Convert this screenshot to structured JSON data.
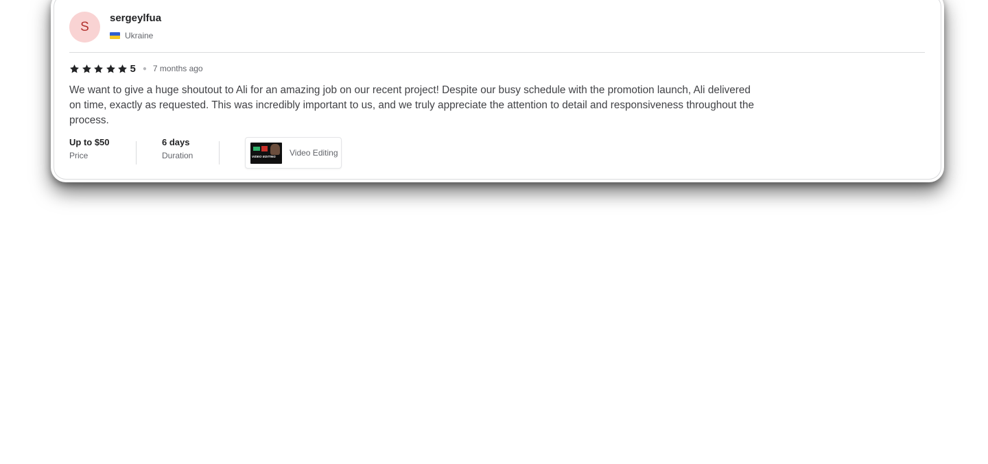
{
  "review": {
    "avatar_initial": "S",
    "username": "sergeylfua",
    "country": "Ukraine",
    "flag_icon": "ukraine-flag-icon",
    "rating": {
      "stars": 5,
      "max_stars": 5,
      "value_label": "5"
    },
    "time_ago": "7 months ago",
    "text": "We want to give a huge shoutout to Ali for an amazing job on our recent project! Despite our busy schedule with the promotion launch, Ali delivered on time, exactly as requested. This was incredibly important to us, and we truly appreciate the attention to detail and responsiveness throughout the process.",
    "price": {
      "value": "Up to $50",
      "label": "Price"
    },
    "duration": {
      "value": "6 days",
      "label": "Duration"
    },
    "gig": {
      "thumbnail_text": "VIDEO EDITING",
      "title": "Video Editing"
    }
  },
  "colors": {
    "avatar_bg": "#f9d3d3",
    "avatar_text": "#b2322f",
    "star": "#222325",
    "text_primary": "#222325",
    "text_secondary": "#62646a",
    "divider": "#dadbdd"
  }
}
